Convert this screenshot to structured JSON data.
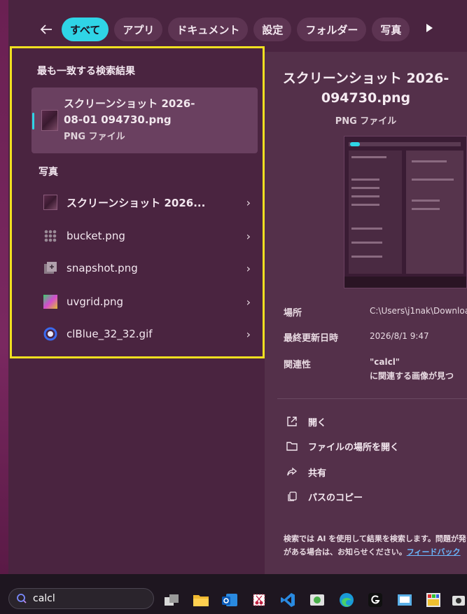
{
  "filter_bar": {
    "chips": [
      "すべて",
      "アプリ",
      "ドキュメント",
      "設定",
      "フォルダー",
      "写真"
    ],
    "active_index": 0
  },
  "results": {
    "best_match_title": "最も一致する検索結果",
    "best_match": {
      "name_line1": "スクリーンショット 2026-",
      "name_line2": "08-01 094730.png",
      "type": "PNG ファイル"
    },
    "photos_title": "写真",
    "photos": [
      {
        "label": "スクリーンショット 2026...",
        "icon": "image-thumb-icon"
      },
      {
        "label": "bucket.png",
        "icon": "grid-dots-icon"
      },
      {
        "label": "snapshot.png",
        "icon": "snapshot-icon"
      },
      {
        "label": "uvgrid.png",
        "icon": "gradient-grid-icon"
      },
      {
        "label": "clBlue_32_32.gif",
        "icon": "blue-ring-icon"
      }
    ]
  },
  "preview": {
    "title_line1": "スクリーンショット 2026-",
    "title_line2": "094730.png",
    "type": "PNG ファイル",
    "meta": [
      {
        "label": "場所",
        "value": "C:\\Users\\j1nak\\Downloa"
      },
      {
        "label": "最終更新日時",
        "value": "2026/8/1 9:47"
      },
      {
        "label": "関連性",
        "value": "\"calcl\""
      }
    ],
    "relevance_line2": "に関連する画像が見つ",
    "actions": [
      {
        "label": "開く",
        "icon": "open-external-icon"
      },
      {
        "label": "ファイルの場所を開く",
        "icon": "folder-icon"
      },
      {
        "label": "共有",
        "icon": "share-icon"
      },
      {
        "label": "パスのコピー",
        "icon": "copy-icon"
      }
    ],
    "notice_line1": "検索では AI を使用して結果を検索します。問題が発",
    "notice_line2": "がある場合は、お知らせください。",
    "feedback_link": "フィードバック"
  },
  "taskbar": {
    "search_value": "calcl"
  }
}
